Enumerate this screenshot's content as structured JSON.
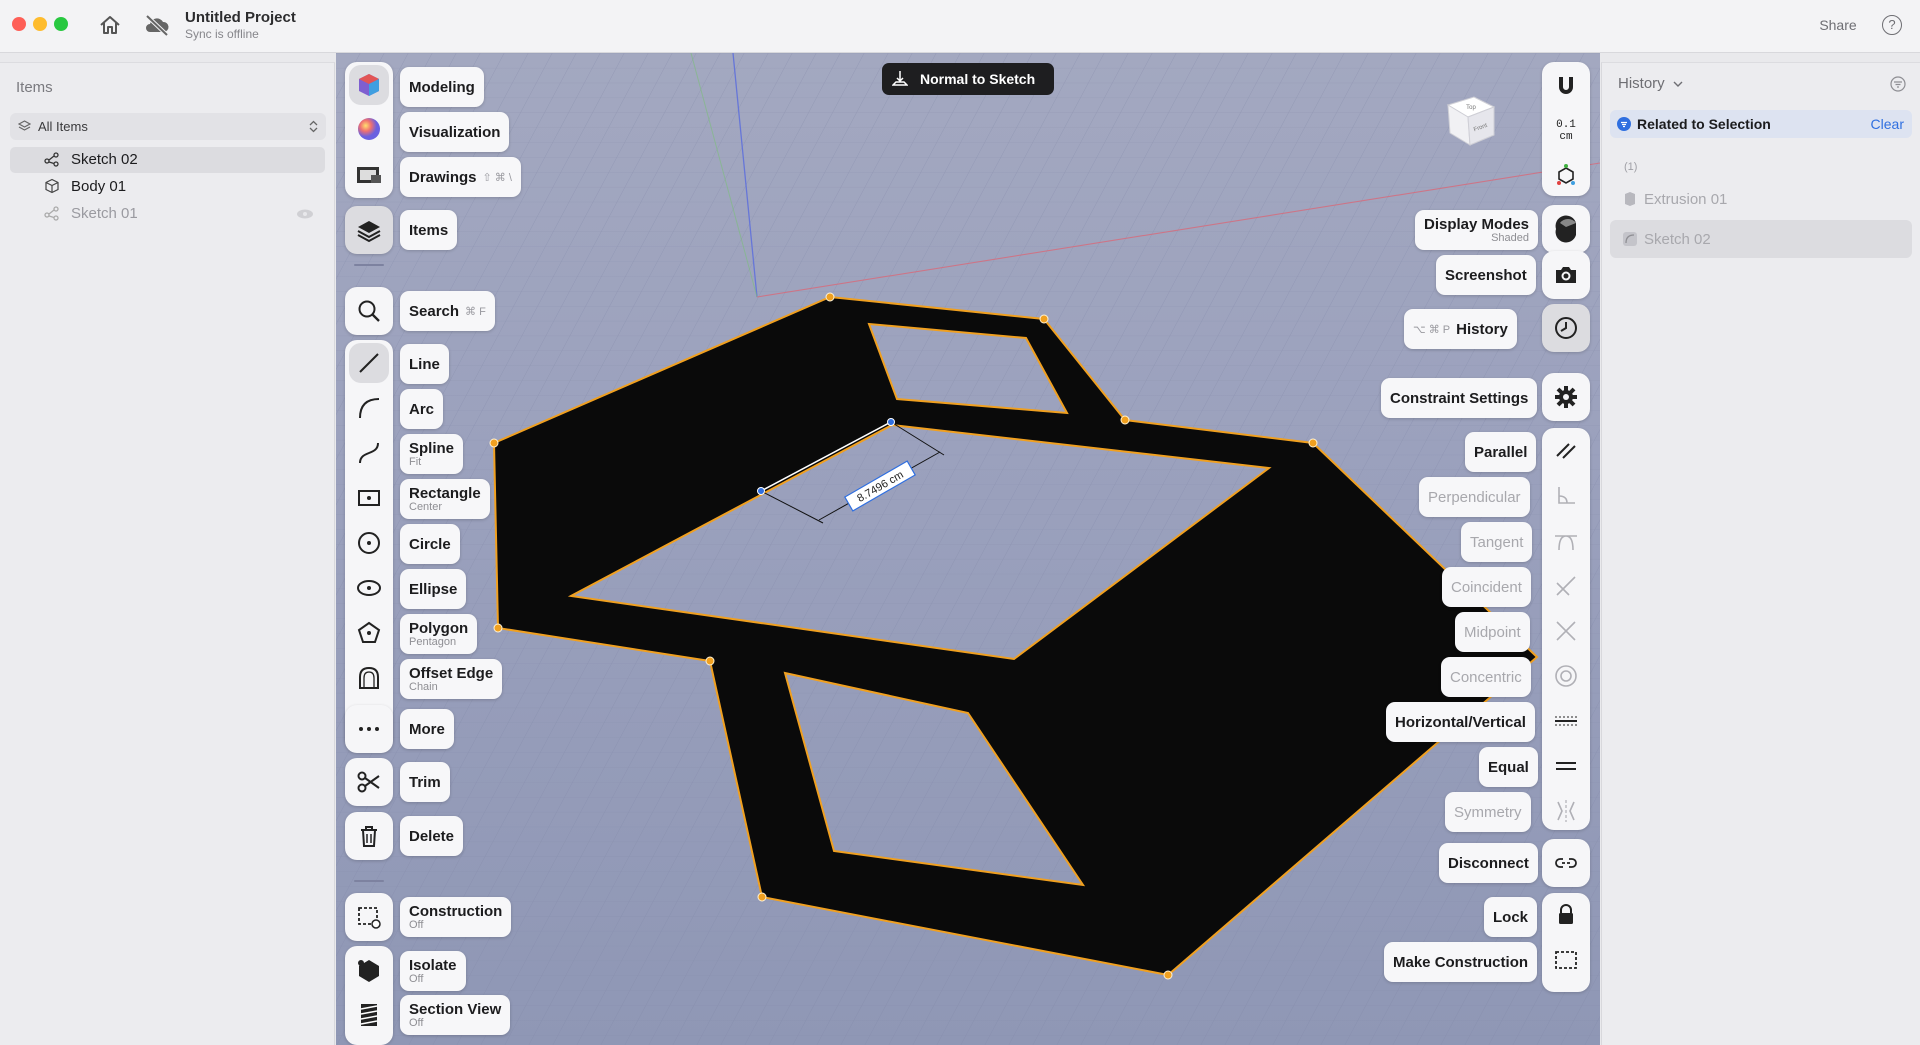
{
  "window": {
    "project_title": "Untitled Project",
    "sync_status": "Sync is offline",
    "share_label": "Share",
    "help_label": "?"
  },
  "left_panel": {
    "title": "Items",
    "filter_label": "All Items",
    "items": [
      {
        "label": "Sketch 02",
        "icon": "sketch-icon",
        "selected": true,
        "dim": false
      },
      {
        "label": "Body 01",
        "icon": "body-icon",
        "selected": false,
        "dim": false
      },
      {
        "label": "Sketch 01",
        "icon": "sketch-icon",
        "selected": false,
        "dim": true
      }
    ]
  },
  "viewport": {
    "normal_to_sketch": "Normal to Sketch",
    "dimension_label": "8.7496 cm",
    "view_cube": {
      "top": "Top",
      "front": "Front"
    }
  },
  "left_toolbar": {
    "workspaces": [
      {
        "label": "Modeling",
        "icon": "modeling-cube-icon"
      },
      {
        "label": "Visualization",
        "icon": "visualization-sphere-icon"
      },
      {
        "label": "Drawings",
        "icon": "drawings-icon",
        "shortcut": "⇧ ⌘ \\"
      }
    ],
    "items": {
      "label": "Items",
      "icon": "layers-icon"
    },
    "search": {
      "label": "Search",
      "icon": "search-icon",
      "shortcut": "⌘ F"
    },
    "tools": [
      {
        "label": "Line",
        "sub": "",
        "icon": "line-icon"
      },
      {
        "label": "Arc",
        "sub": "",
        "icon": "arc-icon"
      },
      {
        "label": "Spline",
        "sub": "Fit",
        "icon": "spline-icon"
      },
      {
        "label": "Rectangle",
        "sub": "Center",
        "icon": "rectangle-icon"
      },
      {
        "label": "Circle",
        "sub": "",
        "icon": "circle-icon"
      },
      {
        "label": "Ellipse",
        "sub": "",
        "icon": "ellipse-icon"
      },
      {
        "label": "Polygon",
        "sub": "Pentagon",
        "icon": "polygon-icon"
      },
      {
        "label": "Offset Edge",
        "sub": "Chain",
        "icon": "offset-edge-icon"
      },
      {
        "label": "More",
        "sub": "",
        "icon": "more-icon"
      }
    ],
    "edit": [
      {
        "label": "Trim",
        "icon": "scissors-icon"
      },
      {
        "label": "Delete",
        "icon": "trash-icon"
      }
    ],
    "modes": [
      {
        "label": "Construction",
        "sub": "Off",
        "icon": "construction-icon"
      },
      {
        "label": "Isolate",
        "sub": "Off",
        "icon": "isolate-icon"
      },
      {
        "label": "Section View",
        "sub": "Off",
        "icon": "section-view-icon"
      }
    ]
  },
  "right_toolbar": {
    "top_group": {
      "snap_icon": "magnet-icon",
      "units_value": "0.1",
      "units_unit": "cm",
      "axis_icon": "axis-triad-icon"
    },
    "display_modes": {
      "label": "Display Modes",
      "sub": "Shaded",
      "icon": "shaded-sphere-icon"
    },
    "screenshot": {
      "label": "Screenshot",
      "icon": "camera-icon"
    },
    "history": {
      "label": "History",
      "shortcut": "⌥ ⌘ P",
      "icon": "clock-icon"
    },
    "constraint_settings": {
      "label": "Constraint Settings",
      "icon": "gear-icon"
    },
    "constraints": [
      {
        "label": "Parallel",
        "icon": "parallel-icon",
        "enabled": true
      },
      {
        "label": "Perpendicular",
        "icon": "perpendicular-icon",
        "enabled": false
      },
      {
        "label": "Tangent",
        "icon": "tangent-icon",
        "enabled": false
      },
      {
        "label": "Coincident",
        "icon": "coincident-icon",
        "enabled": false
      },
      {
        "label": "Midpoint",
        "icon": "midpoint-icon",
        "enabled": false
      },
      {
        "label": "Concentric",
        "icon": "concentric-icon",
        "enabled": false
      },
      {
        "label": "Horizontal/Vertical",
        "icon": "horizontal-vertical-icon",
        "enabled": true
      },
      {
        "label": "Equal",
        "icon": "equal-icon",
        "enabled": true
      },
      {
        "label": "Symmetry",
        "icon": "symmetry-icon",
        "enabled": false
      }
    ],
    "bottom": [
      {
        "label": "Disconnect",
        "icon": "disconnect-icon"
      },
      {
        "label": "Lock",
        "icon": "lock-icon"
      },
      {
        "label": "Make Construction",
        "icon": "make-construction-icon"
      }
    ]
  },
  "right_panel": {
    "title": "History",
    "related_label": "Related to Selection",
    "clear_label": "Clear",
    "group_label": "(1)",
    "items": [
      {
        "label": "Extrusion 01",
        "icon": "extrusion-icon",
        "selected": false
      },
      {
        "label": "Sketch 02",
        "icon": "sketch-history-icon",
        "selected": true
      }
    ]
  },
  "colors": {
    "selection_orange": "#f0a020",
    "accent_blue": "#2f6fe0",
    "sketch_fill": "#0a0a0a"
  }
}
